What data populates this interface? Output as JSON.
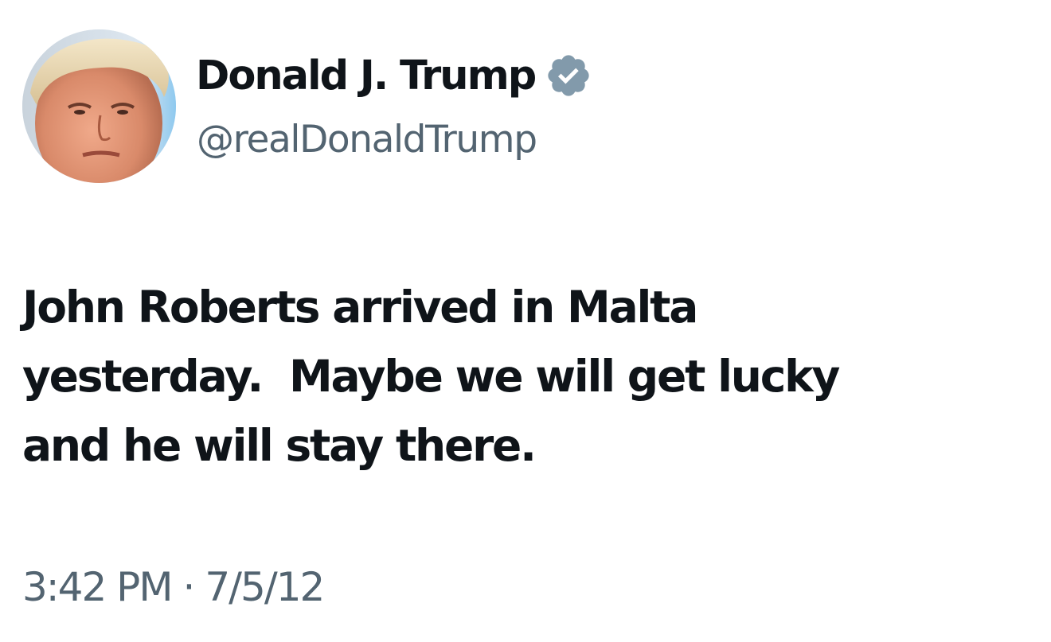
{
  "author": {
    "display_name": "Donald J. Trump",
    "handle": "@realDonaldTrump",
    "verified": true,
    "verified_badge_color": "#829aab"
  },
  "tweet": {
    "text": "John Roberts arrived in Malta\nyesterday.  Maybe we will get lucky\nand he will stay there.",
    "time": "3:42 PM",
    "separator": "·",
    "date": "7/5/12"
  },
  "colors": {
    "text_primary": "#0f1419",
    "text_secondary": "#536471",
    "background": "#ffffff"
  },
  "icons": {
    "verified": "verified-badge-icon",
    "avatar": "profile-photo"
  }
}
